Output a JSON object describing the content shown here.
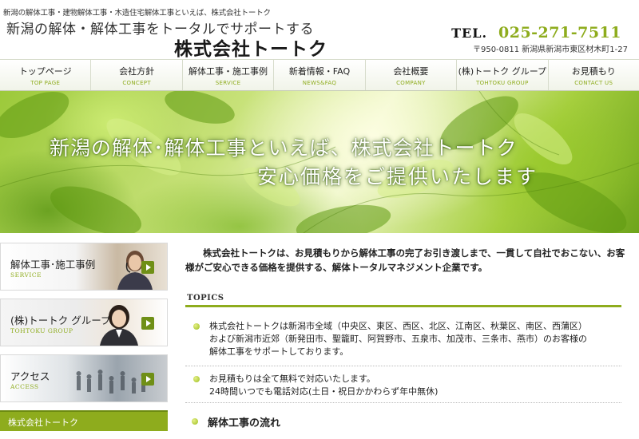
{
  "header": {
    "tagline": "新潟の解体工事・建物解体工事・木造住宅解体工事といえば、株式会社トートク",
    "catchphrase": "新潟の解体・解体工事をトータルでサポートする",
    "company_name": "株式会社トートク",
    "tel_label": "TEL.",
    "tel_number": "025-271-7511",
    "address": "〒950-0811 新潟県新潟市東区材木町1-27"
  },
  "nav": {
    "items": [
      {
        "ja": "トップページ",
        "en": "TOP PAGE"
      },
      {
        "ja": "会社方針",
        "en": "CONCEPT"
      },
      {
        "ja": "解体工事・施工事例",
        "en": "SERVICE"
      },
      {
        "ja": "新着情報・FAQ",
        "en": "NEWS&FAQ"
      },
      {
        "ja": "会社概要",
        "en": "COMPANY"
      },
      {
        "ja": "(株)トートク グループ",
        "en": "TOHTOKU GROUP"
      },
      {
        "ja": "お見積もり",
        "en": "CONTACT US"
      }
    ]
  },
  "hero": {
    "line1": "新潟の解体･解体工事といえば、株式会社トートク",
    "line2": "安心価格をご提供いたします"
  },
  "sidebar": {
    "banners": [
      {
        "title": "解体工事･施工事例",
        "sub": "SERVICE"
      },
      {
        "title": "(株)トートク グループ",
        "sub": "TOHTOKU GROUP"
      },
      {
        "title": "アクセス",
        "sub": "ACCESS"
      }
    ],
    "heading": "株式会社トートク"
  },
  "main": {
    "intro": "株式会社トートクは、お見積もりから解体工事の完了お引き渡しまで、一貫して自社でおこない、お客様がご安心できる価格を提供する、解体トータルマネジメント企業です。",
    "topics_label": "TOPICS",
    "topics": [
      {
        "lines": [
          "株式会社トートクは新潟市全域（中央区、東区、西区、北区、江南区、秋葉区、南区、西蒲区）",
          "および新潟市近郊（新発田市、聖籠町、阿賀野市、五泉市、加茂市、三条市、燕市）のお客様の",
          "解体工事をサポートしております。"
        ]
      },
      {
        "lines": [
          "お見積もりは全て無料で対応いたします。",
          "24時間いつでも電話対応(土日・祝日かかわらず年中無休)"
        ]
      }
    ],
    "flow_heading": "解体工事の流れ"
  },
  "colors": {
    "accent_green": "#8eac1d",
    "dark_green": "#6f8f16",
    "text": "#222222"
  }
}
